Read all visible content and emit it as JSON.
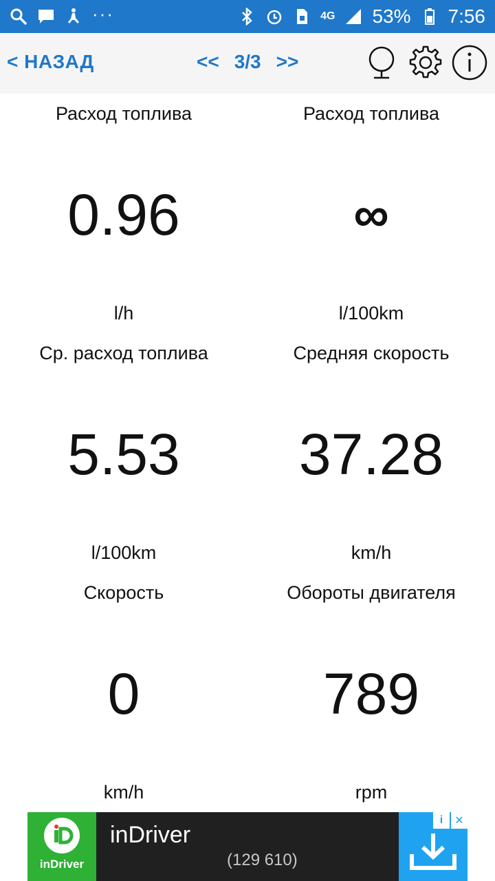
{
  "status_bar": {
    "battery_percent": "53%",
    "time": "7:56",
    "network": "4G",
    "icons": [
      "search-icon",
      "chat-icon",
      "accessibility-icon",
      "more-dots-icon",
      "bluetooth-icon",
      "alarm-icon",
      "sim-icon",
      "signal-icon",
      "battery-icon"
    ]
  },
  "toolbar": {
    "back_label": "< НАЗАД",
    "prev_label": "<<",
    "page_label": "3/3",
    "next_label": ">>",
    "icons": [
      "globe-icon",
      "gear-icon",
      "info-icon"
    ]
  },
  "gauges": [
    {
      "title": "Расход топлива",
      "value": "0.96",
      "unit": "l/h"
    },
    {
      "title": "Расход топлива",
      "value": "∞",
      "unit": "l/100km"
    },
    {
      "title": "Ср. расход топлива",
      "value": "5.53",
      "unit": "l/100km"
    },
    {
      "title": "Средняя скорость",
      "value": "37.28",
      "unit": "km/h"
    },
    {
      "title": "Скорость",
      "value": "0",
      "unit": "km/h"
    },
    {
      "title": "Обороты двигателя",
      "value": "789",
      "unit": "rpm"
    }
  ],
  "ad": {
    "logo_text": "inDriver",
    "title": "inDriver",
    "count": "(129 610)",
    "badge_info": "i",
    "badge_close": "✕",
    "colors": {
      "logo_bg": "#2eb135",
      "cta_bg": "#1fa3f0",
      "body_bg": "#202020"
    }
  },
  "colors": {
    "accent": "#1f78c9",
    "background": "#ffffff",
    "toolbar_bg": "#f5f5f5"
  }
}
